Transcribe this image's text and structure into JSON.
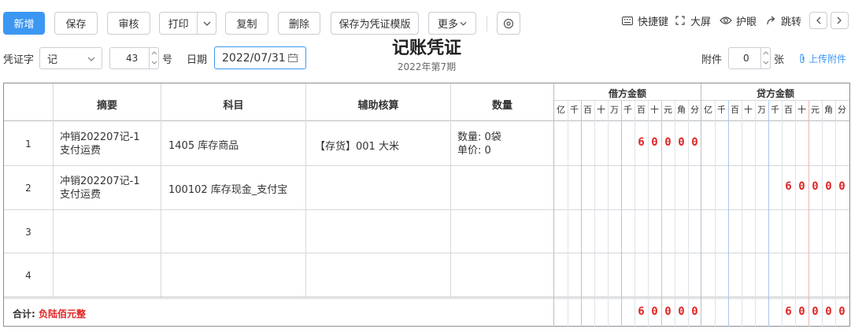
{
  "toolbar": {
    "add": "新增",
    "save": "保存",
    "audit": "审核",
    "print": "打印",
    "copy": "复制",
    "delete": "删除",
    "save_template": "保存为凭证模版",
    "more": "更多"
  },
  "tools": {
    "shortcut": "快捷键",
    "fullscreen": "大屏",
    "eye_care": "护眼",
    "jump": "跳转"
  },
  "form": {
    "word_label": "凭证字",
    "word_value": "记",
    "number_value": "43",
    "number_suffix": "号",
    "date_label": "日期",
    "date_value": "2022/07/31",
    "attach_label": "附件",
    "attach_value": "0",
    "attach_unit": "张",
    "upload": "上传附件"
  },
  "voucher": {
    "title": "记账凭证",
    "period": "2022年第7期"
  },
  "table": {
    "headers": {
      "summary": "摘要",
      "account": "科目",
      "aux": "辅助核算",
      "qty": "数量",
      "debit": "借方金额",
      "credit": "贷方金额"
    },
    "units": [
      "亿",
      "千",
      "百",
      "十",
      "万",
      "千",
      "百",
      "十",
      "元",
      "角",
      "分"
    ],
    "rows": [
      {
        "no": "1",
        "summary_l1": "冲销202207记-1",
        "summary_l2": "支付运费",
        "account": "1405  库存商品",
        "aux": "【存货】001 大米",
        "qty_l1": "数量: 0袋",
        "qty_l2": "单价: 0",
        "debit": "60000",
        "credit": ""
      },
      {
        "no": "2",
        "summary_l1": "冲销202207记-1",
        "summary_l2": "支付运费",
        "account": "100102  库存现金_支付宝",
        "aux": "",
        "qty_l1": "",
        "qty_l2": "",
        "debit": "",
        "credit": "60000"
      },
      {
        "no": "3",
        "summary_l1": "",
        "summary_l2": "",
        "account": "",
        "aux": "",
        "qty_l1": "",
        "qty_l2": "",
        "debit": "",
        "credit": ""
      },
      {
        "no": "4",
        "summary_l1": "",
        "summary_l2": "",
        "account": "",
        "aux": "",
        "qty_l1": "",
        "qty_l2": "",
        "debit": "",
        "credit": ""
      }
    ],
    "total_label": "合计:",
    "total_words": "负陆佰元整",
    "total_debit": "60000",
    "total_credit": "60000"
  },
  "colors": {
    "primary": "#3b97f2",
    "amount_red": "#e02424",
    "link_blue": "#3b97f2"
  },
  "icons": [
    "keyboard-icon",
    "fullscreen-icon",
    "eye-icon",
    "jump-icon",
    "chevron-left-icon",
    "chevron-right-icon",
    "settings-icon",
    "calendar-icon",
    "paperclip-icon",
    "chevron-down-icon"
  ]
}
